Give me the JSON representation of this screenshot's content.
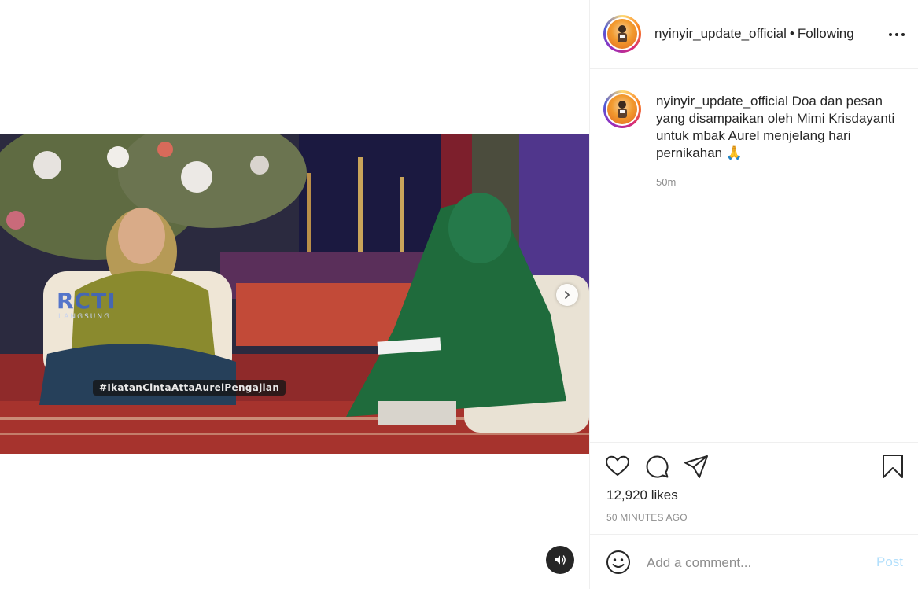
{
  "media": {
    "hashtag": "#IkatanCintaAttaAurelPengajian",
    "channel_logo": "RCTI",
    "channel_sub": "LANGSUNG",
    "next_icon": "chevron-right-icon",
    "sound_icon": "speaker-icon"
  },
  "header": {
    "username": "nyinyir_update_official",
    "separator": "•",
    "follow_state": "Following",
    "more_icon": "more-horizontal-icon"
  },
  "caption": {
    "username": "nyinyir_update_official",
    "text": "Doa dan pesan yang disampaikan oleh Mimi Krisdayanti untuk mbak Aurel menjelang hari pernikahan 🙏",
    "time": "50m"
  },
  "actions": {
    "like_icon": "heart-icon",
    "comment_icon": "comment-icon",
    "share_icon": "send-icon",
    "save_icon": "bookmark-icon"
  },
  "likes": "12,920 likes",
  "post_age": "50 MINUTES AGO",
  "comment": {
    "placeholder": "Add a comment...",
    "post_label": "Post",
    "emoji_icon": "smiley-icon"
  },
  "colors": {
    "text": "#262626",
    "secondary": "#8e8e8e",
    "divider": "#efefef",
    "post_disabled": "#b2dffc"
  }
}
